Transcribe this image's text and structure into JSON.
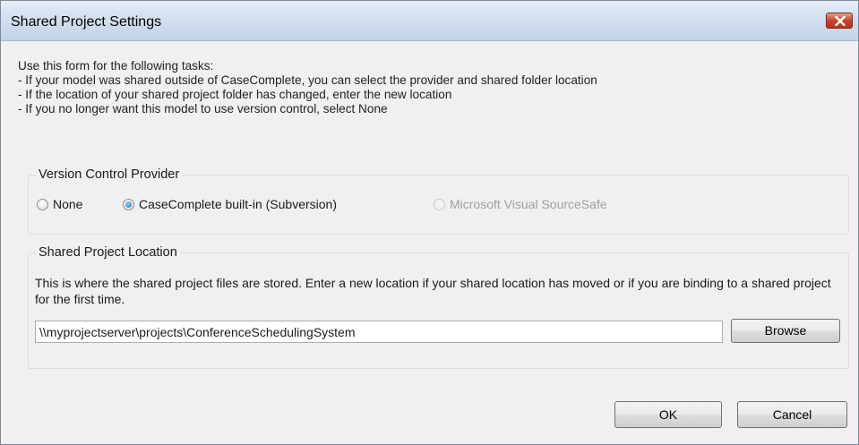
{
  "window": {
    "title": "Shared Project Settings"
  },
  "intro": {
    "lines": [
      "Use this form for the following tasks:",
      "- If your model was shared outside of CaseComplete, you can select the provider and shared folder location",
      "- If the location of your shared project folder has changed, enter the new location",
      "- If you no longer want this model to use version control, select None"
    ]
  },
  "version_control": {
    "label": "Version Control Provider",
    "options": [
      {
        "label": "None",
        "checked": false,
        "enabled": true
      },
      {
        "label": "CaseComplete built-in (Subversion)",
        "checked": true,
        "enabled": true
      },
      {
        "label": "Microsoft Visual SourceSafe",
        "checked": false,
        "enabled": false
      }
    ]
  },
  "location": {
    "label": "Shared Project Location",
    "description": "This is where the shared project files are stored. Enter a new location if your shared location has moved or if you are binding to a shared project for the first time.",
    "path_value": "\\\\myprojectserver\\projects\\ConferenceSchedulingSystem",
    "browse_label": "Browse"
  },
  "buttons": {
    "ok_label": "OK",
    "cancel_label": "Cancel"
  }
}
